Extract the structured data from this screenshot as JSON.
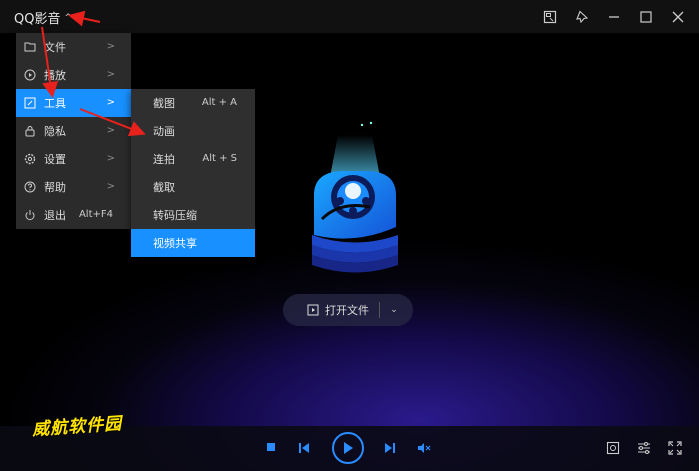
{
  "app": {
    "title": "QQ影音",
    "caret": "^"
  },
  "menu": {
    "items": [
      {
        "label": "文件",
        "icon": "folder-icon"
      },
      {
        "label": "播放",
        "icon": "play-circle-icon"
      },
      {
        "label": "工具",
        "icon": "tools-icon"
      },
      {
        "label": "隐私",
        "icon": "lock-icon"
      },
      {
        "label": "设置",
        "icon": "gear-icon"
      },
      {
        "label": "帮助",
        "icon": "help-icon"
      },
      {
        "label": "退出",
        "icon": "power-icon",
        "shortcut": "Alt+F4"
      }
    ],
    "arrow": ">"
  },
  "submenu": {
    "items": [
      {
        "label": "截图",
        "shortcut": "Alt + A"
      },
      {
        "label": "动画",
        "shortcut": ""
      },
      {
        "label": "连拍",
        "shortcut": "Alt + S"
      },
      {
        "label": "截取",
        "shortcut": ""
      },
      {
        "label": "转码压缩",
        "shortcut": ""
      },
      {
        "label": "视频共享",
        "shortcut": ""
      }
    ]
  },
  "open_file": {
    "label": "打开文件",
    "dropdown": "⌄"
  },
  "watermark": "威航软件园",
  "colors": {
    "accent": "#1890ff",
    "annotation": "#e8211c",
    "watermark": "#ffe400"
  }
}
